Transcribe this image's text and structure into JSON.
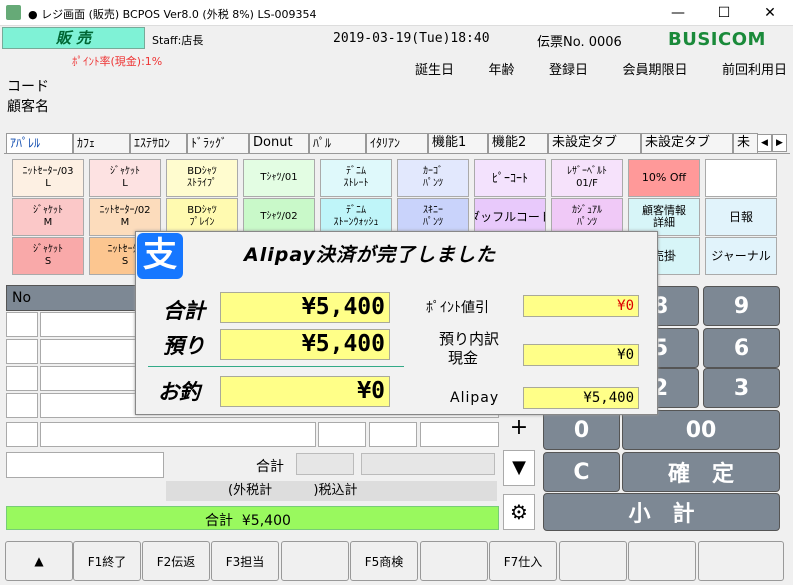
{
  "window": {
    "title": "● レジ画面 (販売)  BCPOS Ver8.0 (外税 8%)  LS-009354"
  },
  "header": {
    "mode": "販 売",
    "staff": "Staff:店長",
    "datetime": "2019-03-19(Tue)18:40",
    "slip": "伝票No. 0006",
    "brand": "BUSICOM",
    "point_rate": "ﾎﾟｲﾝﾄ率(現金):1%",
    "customer_fields": [
      "誕生日",
      "年齢",
      "登録日",
      "会員期限日",
      "前回利用日"
    ],
    "code_label": "コード",
    "customer_name_label": "顧客名"
  },
  "tabs": [
    "ｱﾊﾟﾚﾙ",
    "ｶﾌｪ",
    "ｴｽﾃｻﾛﾝ",
    "ﾄﾞﾗｯｸﾞ",
    "Donut",
    "ﾊﾟﾙ",
    "ｲﾀﾘｱﾝ",
    "機能1",
    "機能2",
    "未設定タブ",
    "未設定タブ",
    "未"
  ],
  "products": {
    "row1": [
      "ﾆｯﾄｾｰﾀｰ/03\nL",
      "ｼﾞｬｹｯﾄ\nL",
      "BDｼｬﾂ\nｽﾄﾗｲﾌﾟ",
      "Tｼｬﾂ/01",
      "ﾃﾞﾆﾑ\nｽﾄﾚｰﾄ",
      "ｶｰｺﾞ\nﾊﾟﾝﾂ",
      "ﾋﾟｰｺｰﾄ",
      "ﾚｻﾞｰﾍﾞﾙﾄ\n01/F",
      "10% Off",
      ""
    ],
    "row2": [
      "ｼﾞｬｹｯﾄ\nM",
      "ﾆｯﾄｾｰﾀｰ/02\nM",
      "BDｼｬﾂ\nﾌﾟﾚｲﾝ",
      "Tｼｬﾂ/02",
      "ﾃﾞﾆﾑ\nｽﾄｰﾝｳｫｯｼｭ",
      "ｽｷﾆｰ\nﾊﾟﾝﾂ",
      "ダッフルコート",
      "ｶｼﾞｭｱﾙ\nﾊﾟﾝﾂ",
      "顧客情報\n詳細",
      "日報"
    ],
    "row3": [
      "ｼﾞｬｹｯﾄ\nS",
      "ﾆｯﾄｾｰﾀｰ\nS",
      "",
      "",
      "",
      "",
      "",
      "",
      "売掛",
      "ジャーナル"
    ]
  },
  "list": {
    "no_header": "No"
  },
  "totals": {
    "total_label": "合計",
    "tax_line": "(外税計          )税込計",
    "summary": "合計  ¥5,400"
  },
  "keypad": {
    "keys": [
      "8",
      "9",
      "5",
      "6",
      "2",
      "3",
      "0",
      "00",
      "C",
      "確　定",
      "小　計"
    ],
    "plus": "+",
    "down": "▼",
    "gear": "⚙"
  },
  "fkeys": [
    "▲",
    "F1終了",
    "F2伝返",
    "F3担当",
    "",
    "F5商検",
    "",
    "F7仕入",
    "",
    "",
    ""
  ],
  "dialog": {
    "title": "Alipay決済が完了しました",
    "logo_char": "支",
    "total_label": "合計",
    "total_value": "¥5,400",
    "received_label": "預り",
    "received_value": "¥5,400",
    "change_label": "お釣",
    "change_value": "¥0",
    "point_discount_label": "ﾎﾟｲﾝﾄ値引",
    "point_discount_value": "¥0",
    "breakdown_label": "預り内訳",
    "cash_label": "現金",
    "cash_value": "¥0",
    "alipay_label": "Alipay",
    "alipay_value": "¥5,400"
  },
  "colors": {
    "mode_bg": "#7ff2d6",
    "brand": "#1a8a3a",
    "summary_bg": "#99f95e",
    "dialog_yellow": "#ffff88",
    "alipay_blue": "#1677ff"
  }
}
